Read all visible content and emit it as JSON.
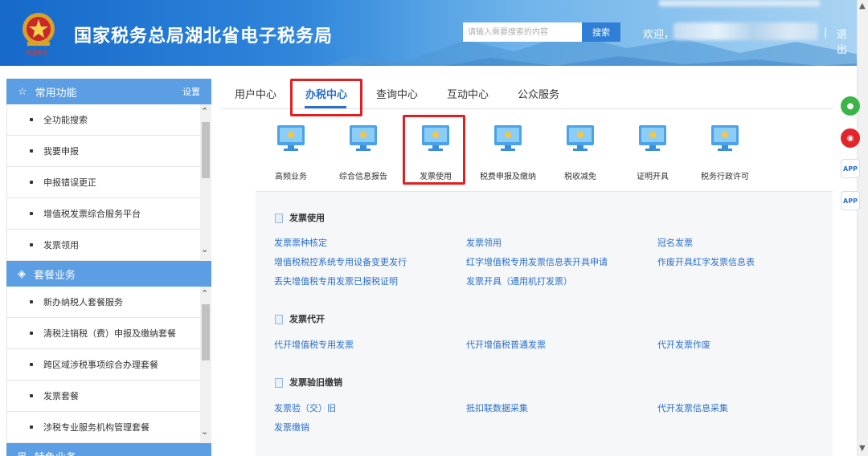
{
  "header": {
    "title": "国家税务总局湖北省电子税务局",
    "search_placeholder": "请输入需要搜索的内容",
    "search_button": "搜索",
    "welcome": "欢迎，",
    "separator": "|",
    "logout": "退出"
  },
  "sidebar": {
    "group1": {
      "title": "常用功能",
      "setting": "设置",
      "items": [
        "全功能搜索",
        "我要申报",
        "申报错误更正",
        "增值税发票综合服务平台",
        "发票领用"
      ]
    },
    "group2": {
      "title": "套餐业务",
      "items": [
        "新办纳税人套餐服务",
        "清税注销税（费）申报及缴纳套餐",
        "跨区域涉税事项综合办理套餐",
        "发票套餐",
        "涉税专业服务机构管理套餐"
      ]
    },
    "group3": {
      "title": "特色业务"
    }
  },
  "tabs": [
    "用户中心",
    "办税中心",
    "查询中心",
    "互动中心",
    "公众服务"
  ],
  "active_tab": "办税中心",
  "functions": [
    "高频业务",
    "综合信息报告",
    "发票使用",
    "税费申报及缴纳",
    "税收减免",
    "证明开具",
    "税务行政许可"
  ],
  "sections": [
    {
      "title": "发票使用",
      "links": [
        "发票票种核定",
        "发票领用",
        "冠名发票",
        "增值税税控系统专用设备变更发行",
        "红字增值税专用发票信息表开具申请",
        "作废开具红字发票信息表",
        "丢失增值税专用发票已报税证明",
        "发票开具（通用机打发票）"
      ]
    },
    {
      "title": "发票代开",
      "links": [
        "代开增值税专用发票",
        "代开增值税普通发票",
        "代开发票作废"
      ]
    },
    {
      "title": "发票验旧缴销",
      "links": [
        "发票验（交）旧",
        "抵扣联数据采集",
        "代开发票信息采集",
        "发票缴销"
      ]
    }
  ],
  "floating_icons": [
    "wechat-icon",
    "weibo-icon",
    "app-icon",
    "app-icon"
  ],
  "colors": {
    "accent": "#2a6fc9",
    "sidebar_header": "#5b9ee3",
    "highlight": "#e02020"
  }
}
